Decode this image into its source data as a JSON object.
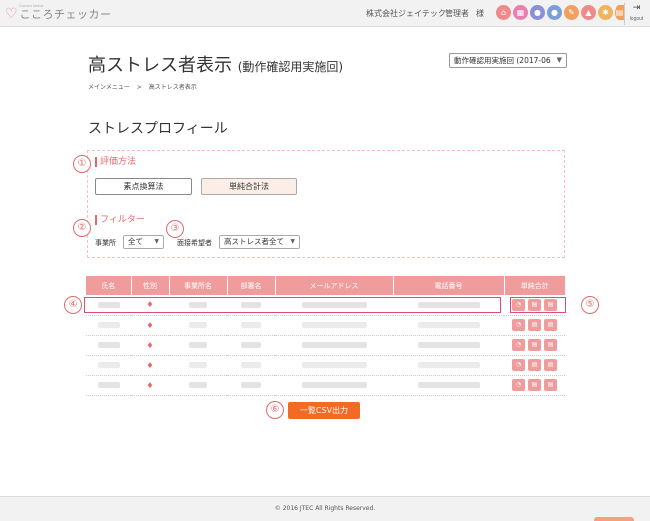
{
  "header": {
    "logo_small": "Cocoro check",
    "logo": "こころチェッカー",
    "company": "株式会社ジェイテック",
    "admin": "管理者",
    "sama": "様",
    "nav_icons": [
      {
        "name": "home-icon",
        "color": "#f08a8a"
      },
      {
        "name": "building-icon",
        "color": "#e87fae"
      },
      {
        "name": "person-icon",
        "color": "#8b8fd6"
      },
      {
        "name": "people-icon",
        "color": "#7d9fd8"
      },
      {
        "name": "settings-icon",
        "color": "#f2a05e"
      },
      {
        "name": "warning-icon",
        "color": "#f08a8a"
      },
      {
        "name": "gear-icon",
        "color": "#f0b45e"
      },
      {
        "name": "book-icon",
        "color": "#f2a05e"
      }
    ],
    "logout": "logout"
  },
  "page": {
    "title": "高ストレス者表示",
    "subtitle": "(動作確認用実施回)",
    "round_select": "動作確認用実施回 (2017-06",
    "breadcrumb": [
      "メインメニュー",
      ">",
      "高ストレス者表示"
    ],
    "section_title": "ストレスプロフィール"
  },
  "evaluation": {
    "label": "評価方法",
    "btn_score": "素点換算法",
    "btn_simple": "単純合計法"
  },
  "filter": {
    "label": "フィルター",
    "office_label": "事業所",
    "office_value": "全て",
    "interview_label": "面接希望者",
    "interview_value": "高ストレス者全て"
  },
  "table": {
    "headers": [
      "氏名",
      "性別",
      "事業所名",
      "部署名",
      "メールアドレス",
      "電話番号",
      "単純合計"
    ],
    "row_count": 5
  },
  "csv_button": "一覧CSV出力",
  "footer": "© 2016 JTEC All Rights Reserved.",
  "markers": [
    "①",
    "②",
    "③",
    "④",
    "⑤",
    "⑥"
  ],
  "colors": {
    "accent": "#e46a6a",
    "header": "#f19c9c",
    "csv": "#f26a23"
  }
}
